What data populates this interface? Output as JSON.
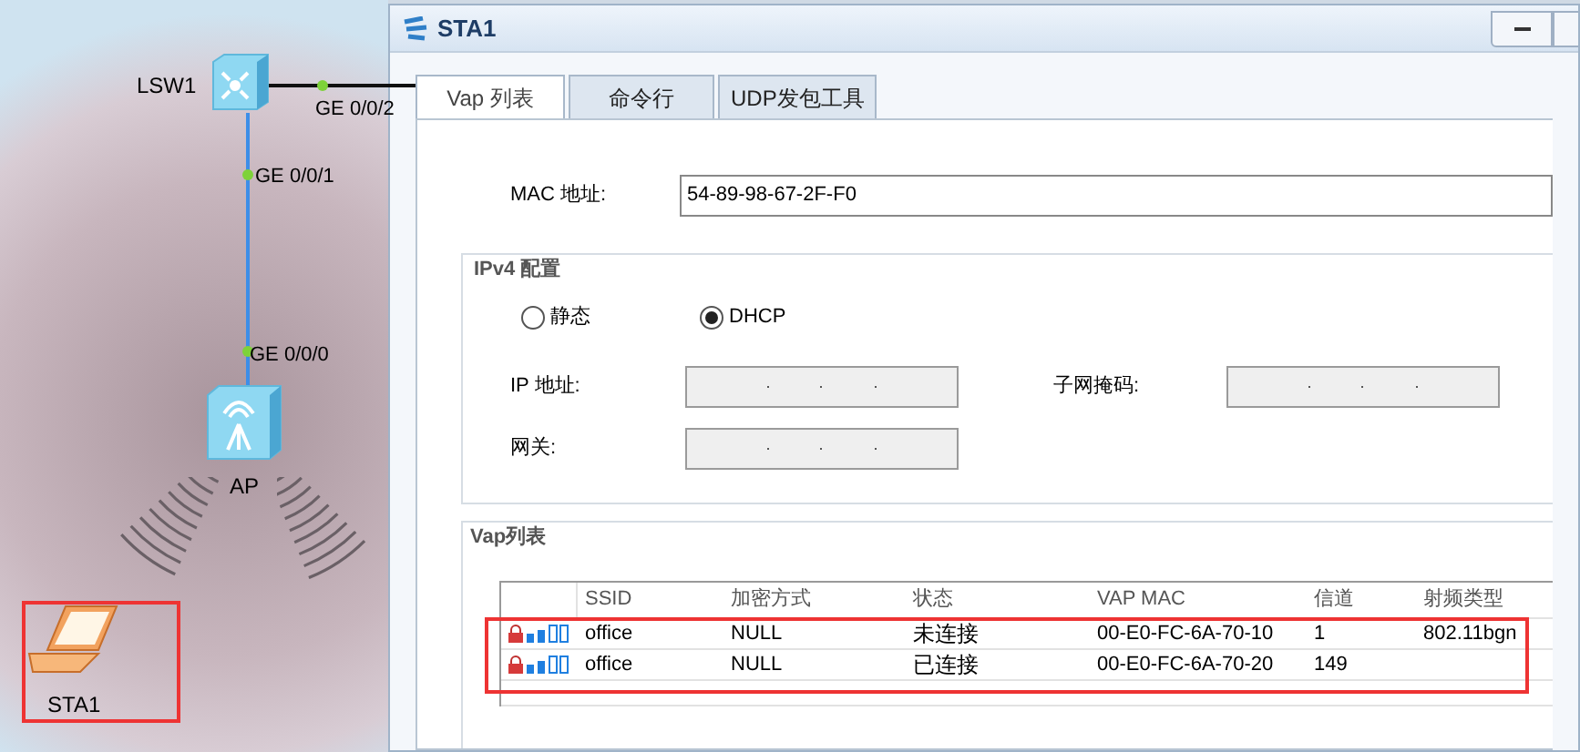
{
  "topology": {
    "nodes": [
      {
        "kind": "switch",
        "label": "LSW1"
      },
      {
        "kind": "ap",
        "label": "AP"
      },
      {
        "kind": "laptop",
        "label": "STA1"
      }
    ],
    "ports": [
      "GE 0/0/2",
      "GE 0/0/1",
      "GE 0/0/0"
    ]
  },
  "window": {
    "title": "STA1"
  },
  "tabs": [
    {
      "label": "Vap 列表",
      "selected": true
    },
    {
      "label": "命令行",
      "selected": false
    },
    {
      "label": "UDP发包工具",
      "selected": false
    }
  ],
  "mac": {
    "label": "MAC 地址:",
    "value": "54-89-98-67-2F-F0"
  },
  "ipv4": {
    "title": "IPv4 配置",
    "modes": [
      {
        "label": "静态",
        "selected": false
      },
      {
        "label": "DHCP",
        "selected": true
      }
    ],
    "ip": {
      "label": "IP 地址:",
      "disabled": true
    },
    "mask": {
      "label": "子网掩码:",
      "disabled": true
    },
    "gateway": {
      "label": "网关:",
      "disabled": true
    }
  },
  "vap": {
    "title": "Vap列表",
    "columns": [
      "SSID",
      "加密方式",
      "状态",
      "VAP MAC",
      "信道",
      "射频类型"
    ],
    "rows": [
      {
        "ssid": "office",
        "encryption": "NULL",
        "status": "未连接",
        "vap_mac": "00-E0-FC-6A-70-10",
        "channel": "1",
        "radio_type": "802.11bgn"
      },
      {
        "ssid": "office",
        "encryption": "NULL",
        "status": "已连接",
        "vap_mac": "00-E0-FC-6A-70-20",
        "channel": "149"
      }
    ]
  }
}
